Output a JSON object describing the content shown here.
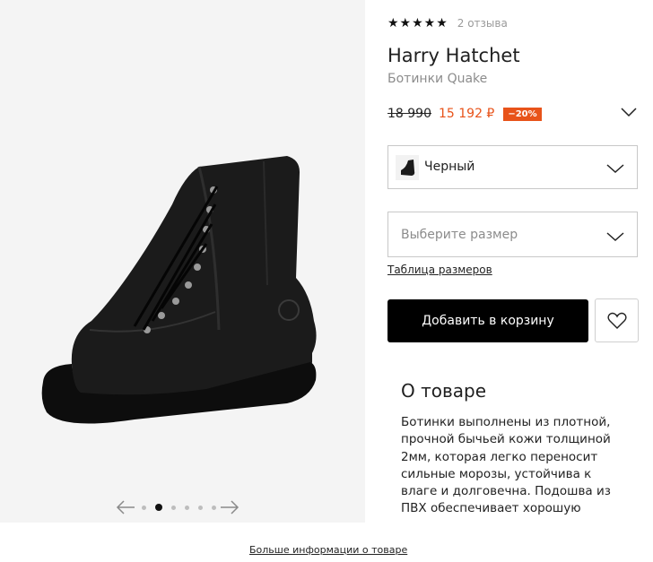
{
  "product": {
    "rating_stars": "★★★★★",
    "rating_value": 5,
    "reviews": "2 отзыва",
    "brand": "Harry Hatchet",
    "subtitle": "Ботинки Quake",
    "old_price": "18 990",
    "new_price": "15 192 ₽",
    "discount": "−20%"
  },
  "color_select": {
    "value": "Черный",
    "icon": "chevron-down-icon"
  },
  "size_select": {
    "placeholder": "Выберите размер",
    "icon": "chevron-down-icon"
  },
  "size_table_link": "Таблица размеров",
  "cart_button": "Добавить в корзину",
  "favorite_icon": "heart-icon",
  "about": {
    "title": "О товаре",
    "text": "Ботинки выполнены из плотной, прочной бычьей кожи толщиной 2мм, которая легко переносит сильные морозы, устойчива к влаге и долговечна. Подошва из ПВХ обеспечивает хорошую"
  },
  "gallery": {
    "dot_count": 6,
    "active_index": 1
  },
  "more_info_link": "Больше информации о товаре",
  "colors": {
    "accent": "#e8531a",
    "button": "#000000",
    "border": "#c8c8c8"
  }
}
